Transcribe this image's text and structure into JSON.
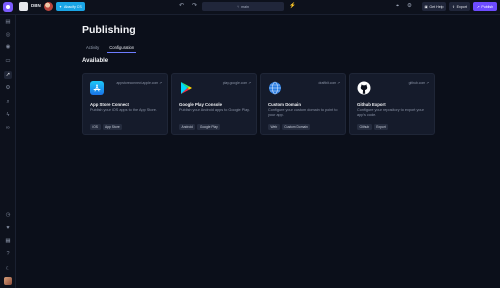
{
  "topbar": {
    "brand": "DBN",
    "ai_button": "Abacify CS",
    "branch": "main",
    "help_label": "Get Help",
    "export_label": "Export",
    "publish_label": "Publish"
  },
  "page": {
    "title": "Publishing",
    "tabs": [
      "Activity",
      "Configuration"
    ],
    "active_tab": "Configuration",
    "section_title": "Available"
  },
  "cards": [
    {
      "url": "appstoreconnect.apple.com",
      "title": "App Store Connect",
      "description": "Publish your iOS apps to the App Store.",
      "tags": [
        "iOS",
        "App Store"
      ],
      "icon": "app-store-icon"
    },
    {
      "url": "play.google.com",
      "title": "Google Play Console",
      "description": "Publish your Android apps to Google Play.",
      "tags": [
        "Android",
        "Google Play"
      ],
      "icon": "google-play-icon"
    },
    {
      "url": "draftbit.com",
      "title": "Custom Domain",
      "description": "Configure your custom domain to point to your app.",
      "tags": [
        "Web",
        "Custom Domain"
      ],
      "icon": "globe-icon"
    },
    {
      "url": "github.com",
      "title": "Github Export",
      "description": "Configure your repository to export your app's code.",
      "tags": [
        "Github",
        "Export"
      ],
      "icon": "github-icon"
    }
  ],
  "colors": {
    "background": "#0b0f1a",
    "card": "#151b2b",
    "accent": "#6d4cff",
    "ai_button": "#1aa5e6"
  }
}
